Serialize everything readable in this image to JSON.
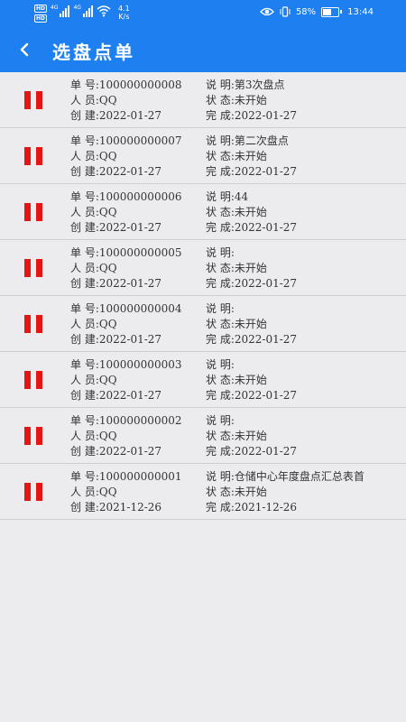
{
  "statusbar": {
    "badge_top": "HD",
    "badge_bottom": "HD",
    "net1": "4G",
    "net2": "4G",
    "speed_value": "4.1",
    "speed_unit": "K/s",
    "battery_text": "58%",
    "battery_level": 0.58,
    "time": "13:44"
  },
  "header": {
    "title": "选盘点单"
  },
  "labels": {
    "order": "单 号:",
    "person": "人 员:",
    "created": "创 建:",
    "desc": "说 明:",
    "status": "状 态:",
    "done": "完 成:"
  },
  "orders": [
    {
      "no": "100000000008",
      "person": "QQ",
      "created": "2022-01-27",
      "desc": "第3次盘点",
      "status": "未开始",
      "done": "2022-01-27"
    },
    {
      "no": "100000000007",
      "person": "QQ",
      "created": "2022-01-27",
      "desc": "第二次盘点",
      "status": "未开始",
      "done": "2022-01-27"
    },
    {
      "no": "100000000006",
      "person": "QQ",
      "created": "2022-01-27",
      "desc": "44",
      "status": "未开始",
      "done": "2022-01-27"
    },
    {
      "no": "100000000005",
      "person": "QQ",
      "created": "2022-01-27",
      "desc": "",
      "status": "未开始",
      "done": "2022-01-27"
    },
    {
      "no": "100000000004",
      "person": "QQ",
      "created": "2022-01-27",
      "desc": "",
      "status": "未开始",
      "done": "2022-01-27"
    },
    {
      "no": "100000000003",
      "person": "QQ",
      "created": "2022-01-27",
      "desc": "",
      "status": "未开始",
      "done": "2022-01-27"
    },
    {
      "no": "100000000002",
      "person": "QQ",
      "created": "2022-01-27",
      "desc": "",
      "status": "未开始",
      "done": "2022-01-27"
    },
    {
      "no": "100000000001",
      "person": "QQ",
      "created": "2021-12-26",
      "desc": "仓储中心年度盘点汇总表首",
      "status": "未开始",
      "done": "2021-12-26"
    }
  ],
  "colors": {
    "primary": "#1e7ff0",
    "icon_red": "#e81414",
    "background": "#ecebee"
  },
  "icons": {
    "back": "chevron-left-icon",
    "row": "pause-icon",
    "eye": "eye-icon",
    "vibrate": "vibrate-icon",
    "wifi": "wifi-icon",
    "battery": "battery-icon"
  }
}
